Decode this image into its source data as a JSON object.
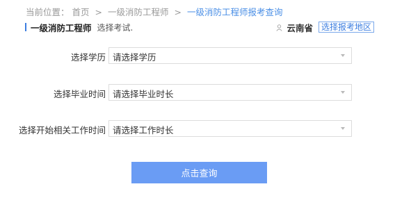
{
  "breadcrumb": {
    "prefix": "当前位置：",
    "items": [
      "首页",
      "一级消防工程师",
      "一级消防工程师报考查询"
    ],
    "separator": ">"
  },
  "subheader": {
    "title": "一级消防工程师",
    "hint": "选择考试."
  },
  "region": {
    "province": "云南省",
    "change_label": "选择报考地区"
  },
  "form": {
    "fields": [
      {
        "label": "选择学历",
        "value": "请选择学历"
      },
      {
        "label": "选择毕业时间",
        "value": "请选择毕业时长"
      },
      {
        "label": "选择开始相关工作时间",
        "value": "请选择工作时长"
      }
    ],
    "submit_label": "点击查询"
  },
  "colors": {
    "accent": "#3b7de0",
    "button": "#6a9cf4",
    "breadcrumb_current": "#4b8fe6"
  }
}
